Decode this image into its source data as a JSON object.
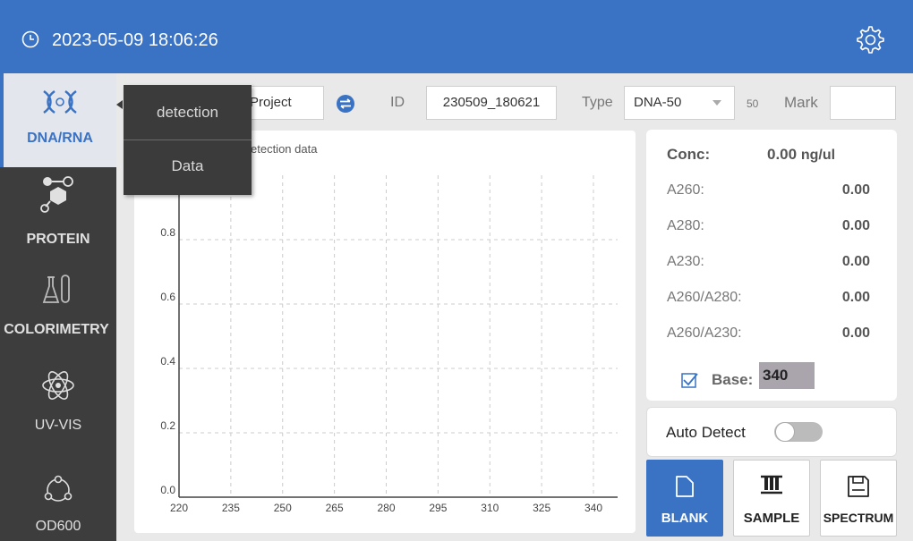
{
  "header": {
    "datetime": "2023-05-09 18:06:26",
    "clock_icon": "clock-icon",
    "settings_icon": "gear-icon"
  },
  "sidebar": {
    "items": [
      {
        "label": "DNA/RNA",
        "icon": "dna-icon",
        "active": true
      },
      {
        "label": "PROTEIN",
        "icon": "molecule-icon"
      },
      {
        "label": "COLORIMETRY",
        "icon": "flask-icon"
      },
      {
        "label": "UV-VIS",
        "icon": "atom-icon"
      },
      {
        "label": "OD600",
        "icon": "cell-cycle-icon"
      }
    ]
  },
  "toolbar": {
    "project_value": "Project",
    "swap_icon": "swap-icon",
    "id_label": "ID",
    "id_value": "230509_180621",
    "type_label": "Type",
    "type_value": "DNA-50",
    "type_factor": "50",
    "mark_label": "Mark",
    "mark_value": ""
  },
  "menu": {
    "items": [
      "detection",
      "Data"
    ]
  },
  "chart_data": {
    "type": "line",
    "title": "etection data",
    "x_ticks": [
      "220",
      "235",
      "250",
      "265",
      "280",
      "295",
      "310",
      "325",
      "340"
    ],
    "y_ticks": [
      "0.0",
      "0.2",
      "0.4",
      "0.6",
      "0.8"
    ],
    "xlim": [
      220,
      347
    ],
    "ylim": [
      0,
      1.0
    ],
    "grid": true,
    "series": []
  },
  "results": {
    "conc_label": "Conc:",
    "conc_value": "0.00",
    "conc_unit": "ng/ul",
    "rows": [
      {
        "label": "A260:",
        "value": "0.00"
      },
      {
        "label": "A280:",
        "value": "0.00"
      },
      {
        "label": "A230:",
        "value": "0.00"
      },
      {
        "label": "A260/A280:",
        "value": "0.00"
      },
      {
        "label": "A260/A230:",
        "value": "0.00"
      }
    ],
    "base_checked": true,
    "base_label": "Base:",
    "base_value": "340"
  },
  "auto_detect": {
    "label": "Auto Detect",
    "enabled": false
  },
  "actions": [
    {
      "label": "BLANK",
      "icon": "file-icon"
    },
    {
      "label": "SAMPLE",
      "icon": "test-tubes-icon"
    },
    {
      "label": "SPECTRUM",
      "icon": "save-icon"
    }
  ],
  "colors": {
    "primary": "#3a72c4",
    "sidebar": "#3d3d3d",
    "menu": "#3b3b3b"
  }
}
